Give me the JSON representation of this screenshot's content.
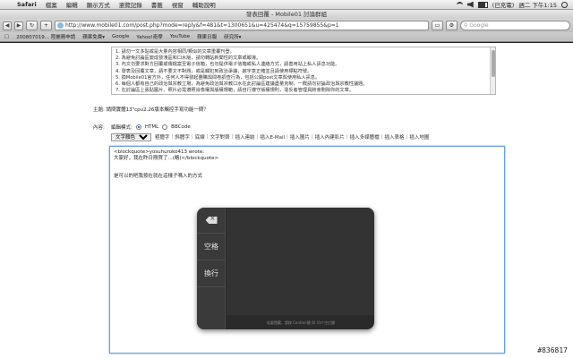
{
  "menubar": {
    "app": "Safari",
    "items": [
      "檔案",
      "編輯",
      "顯示方式",
      "瀏覽記錄",
      "書籤",
      "視窗",
      "輔助說明"
    ],
    "status": "(已充電)",
    "clock": "週二 下午1:15"
  },
  "window": {
    "title": "發表回覆 - Mobile01 討論群組"
  },
  "toolbar": {
    "back": "◀",
    "forward": "▶",
    "url": "http://www.mobile01.com/post.php?mode=reply&f=481&t=1300651&u=425474&q=15759855&p=1",
    "search_placeholder": "Google"
  },
  "bookmarks": [
    "200807019...  陸麗務申請",
    "蘋果免費▾",
    "Google",
    "Yahoo!奇摩",
    "YouTube",
    "蘋果日報",
    "研究所▾"
  ],
  "rules": [
    "1. 請勿一文多貼或是大量內容相同/類似的文章重覆刊登。",
    "2. 為避免討論區變成發洩區和口水版，請勿轉貼新聞性的文章或報導。",
    "3. 內文勿要求對方回覆或傳檔案至電子信箱，也勿提供電子信箱或私人連絡方式，請善用站上私人訊息功能。",
    "4. 發表及回覆文章，請不要文不對題，或是觸犯到政治爭議，謝字意正確並且請使用標點符號。",
    "5. 換Mobile01官方外，任何人不得發起團購與問卷調查行為，包括公開post文章與使用私人訊息。",
    "6. 每個人都有自己的政治與宗教立場，為避免政治與宗教口水在此討論區建議盡量克制，一概請勿討論政治與宗教性議題。",
    "7. 在討論區上張貼圖片、照片必需遵照肖像權與版權規範，請自行遵守版權規則，違反者管理員將會刪除你的文章。"
  ],
  "form": {
    "subject_label": "主題:",
    "subject_value": "請問實體13\"cpu2.26版本觸控手寫功能一問？",
    "content_label": "內容:",
    "mode_label": "編輯模式:",
    "mode_html": "HTML",
    "mode_bbcode": "BBCode",
    "color_select": "文字顏色",
    "format_links": [
      "粗體字",
      "斜體字",
      "底線",
      "文字對齊",
      "插入連結",
      "插入E-Mail",
      "插入圖片",
      "插入內建影片",
      "插入多媒體檔",
      "插入表格",
      "插入地圖"
    ]
  },
  "editor": {
    "lines": [
      "<blockquote>yosuhuroko413 wrote:",
      "大家好，我在昨日剛買了...(略)</blockquote>"
    ],
    "reply": "是可以的吧我按在就在這樣子嗎入的方式"
  },
  "palette": {
    "delete_icon": "delete-icon",
    "space_label": "空格",
    "enter_label": "換行",
    "hint": "若要隱藏，請按 Control-鍵 與 Ctrl-空白鍵"
  },
  "watermark": "#836817"
}
